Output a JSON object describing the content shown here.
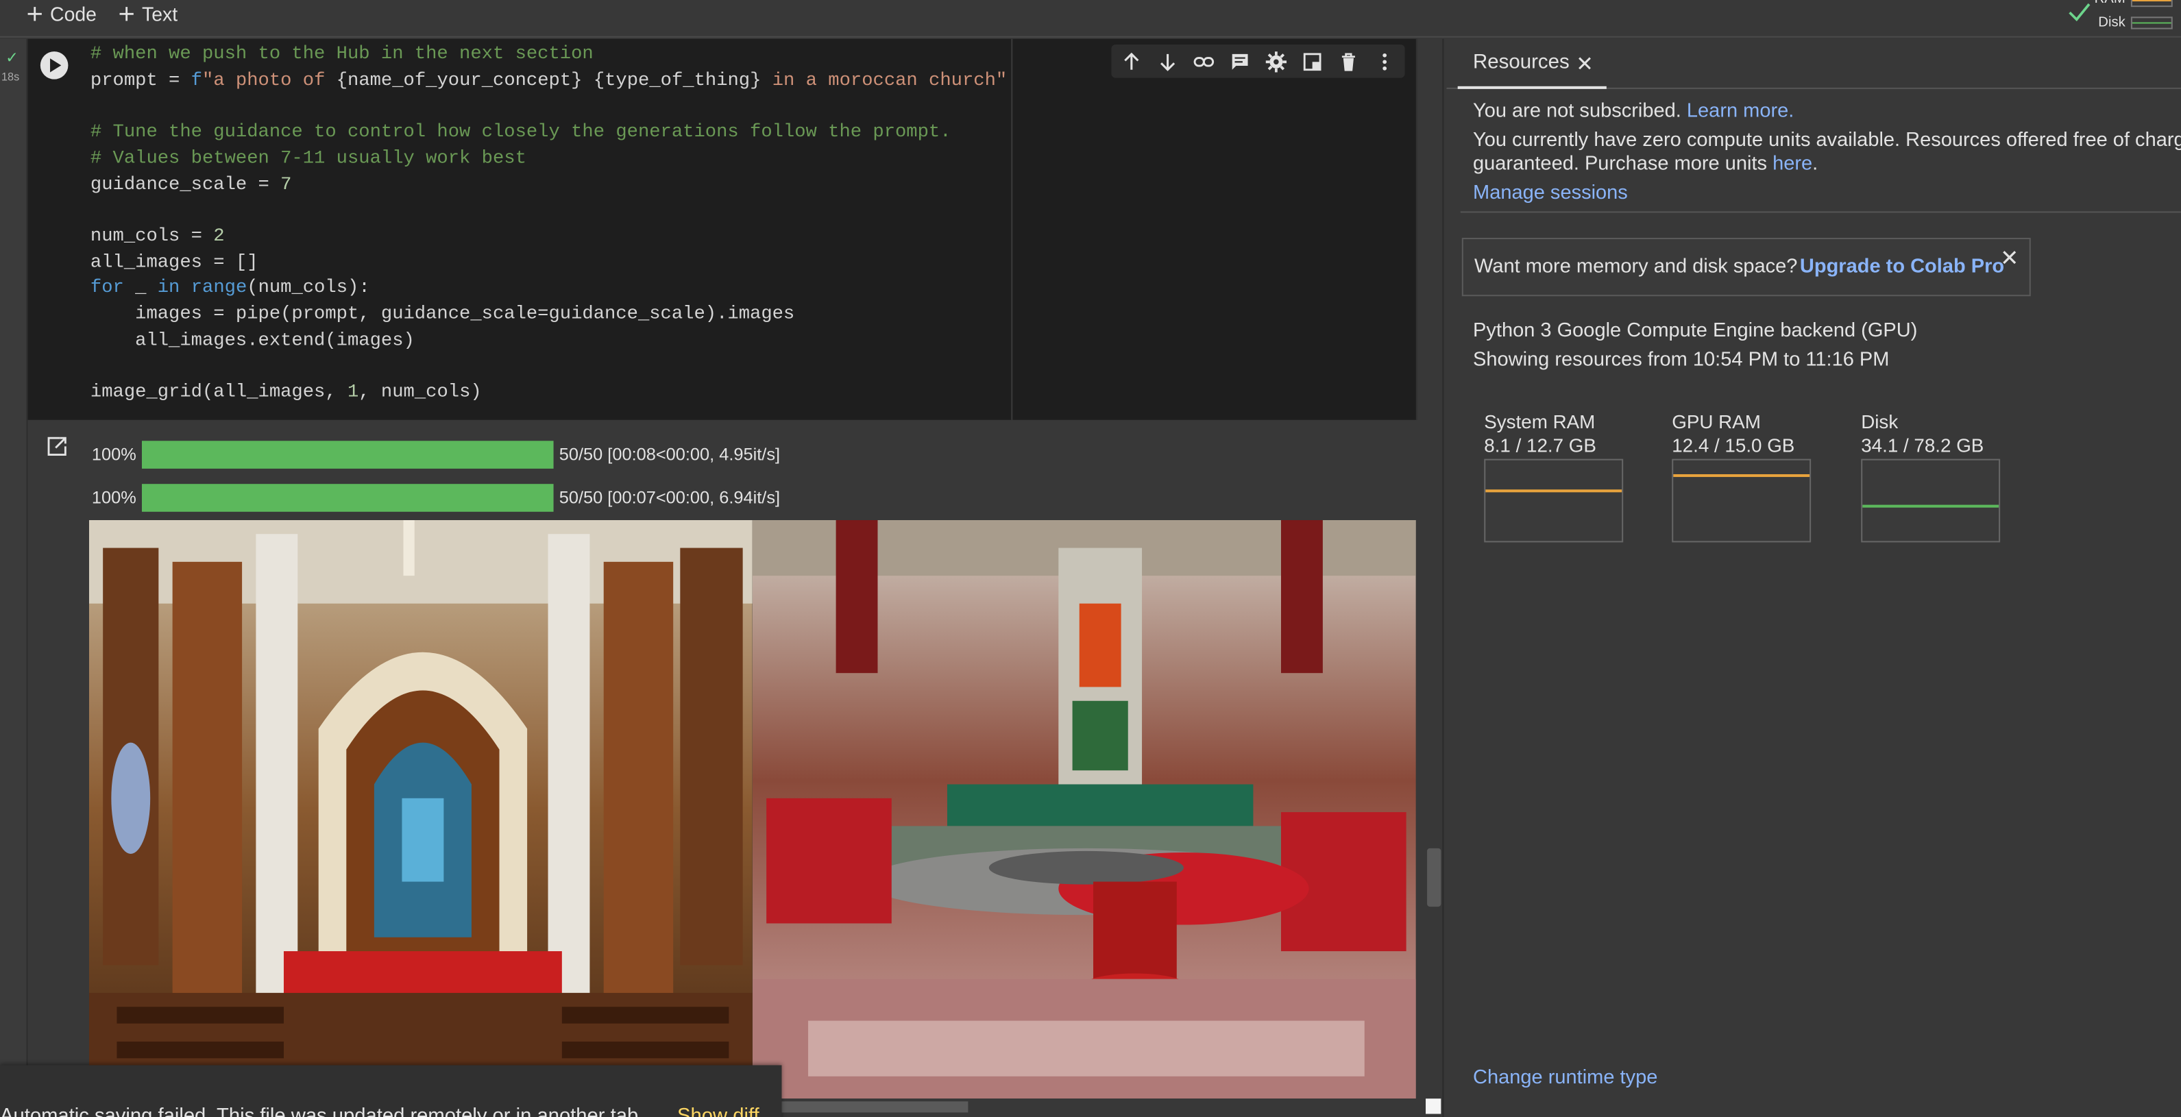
{
  "toolbar": {
    "code_label": "Code",
    "text_label": "Text",
    "ram_label": "RAM",
    "disk_label": "Disk"
  },
  "cell": {
    "exec_time": "18s",
    "code_lines": [
      "# when we push to the Hub in the next section",
      "prompt = f\"a photo of {name_of_your_concept} {type_of_thing} in a moroccan church\"",
      "",
      "# Tune the guidance to control how closely the generations follow the prompt.",
      "# Values between 7-11 usually work best",
      "guidance_scale = 7",
      "",
      "num_cols = 2",
      "all_images = []",
      "for _ in range(num_cols):",
      "    images = pipe(prompt, guidance_scale=guidance_scale).images",
      "    all_images.extend(images)",
      "",
      "image_grid(all_images, 1, num_cols)"
    ]
  },
  "output": {
    "progress": [
      {
        "percent_label": "100%",
        "fraction": 1.0,
        "info": "50/50 [00:08<00:00, 4.95it/s]"
      },
      {
        "percent_label": "100%",
        "fraction": 1.0,
        "info": "50/50 [00:07<00:00, 6.94it/s]"
      }
    ],
    "images": [
      {
        "icon": "generated-image-moroccan-church-arches"
      },
      {
        "icon": "generated-image-moroccan-interior-red-sofa"
      }
    ]
  },
  "toast": {
    "message": "Automatic saving failed. This file was updated remotely or in another tab.",
    "link": "Show diff"
  },
  "resources": {
    "tab_label": "Resources",
    "not_subscribed": "You are not subscribed.",
    "learn_more": "Learn more.",
    "compute_line1": "You currently have zero compute units available. Resources offered free of charge a",
    "compute_line2_pre": "guaranteed. Purchase more units ",
    "here_link": "here",
    "compute_line2_post": ".",
    "manage_sessions": "Manage sessions",
    "upsell_text": "Want more memory and disk space?",
    "upsell_link": "Upgrade to Colab Pro",
    "backend": "Python 3 Google Compute Engine backend (GPU)",
    "showing": "Showing resources from 10:54 PM to 11:16 PM",
    "gauges": [
      {
        "name": "System RAM",
        "value": "8.1 / 12.7 GB",
        "fraction": 0.64,
        "color": "#e8a33d"
      },
      {
        "name": "GPU RAM",
        "value": "12.4 / 15.0 GB",
        "fraction": 0.83,
        "color": "#e8a33d"
      },
      {
        "name": "Disk",
        "value": "34.1 / 78.2 GB",
        "fraction": 0.44,
        "color": "#5cb85c"
      }
    ],
    "change_runtime": "Change runtime type"
  },
  "colors": {
    "accent_link": "#8ab4f8",
    "progress_green": "#5cb85c",
    "toast_link": "#fdd663"
  }
}
